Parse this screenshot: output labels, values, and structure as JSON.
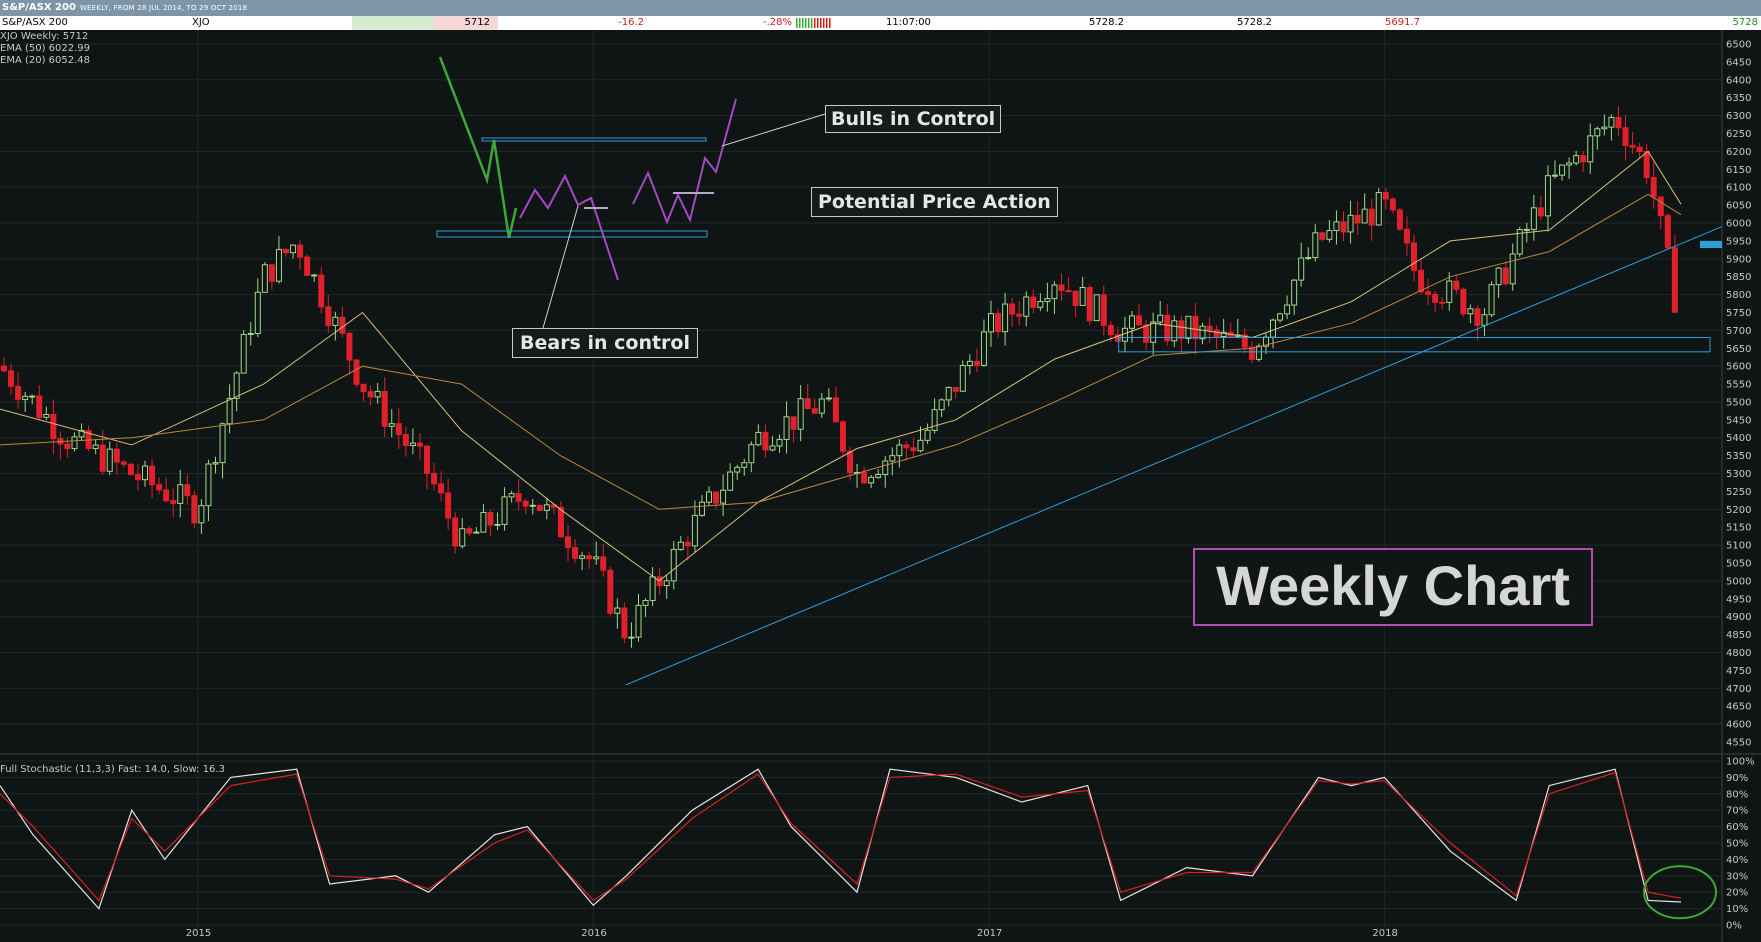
{
  "header": {
    "title": "S&P/ASX 200",
    "range": "WEEKLY, FROM 28 JUL 2014, TO 29 OCT 2018"
  },
  "quote": {
    "name": "S&P/ASX 200",
    "symbol": "XJO",
    "last": "5712",
    "change": "-16.2",
    "change_pct": "-.28%",
    "time": "11:07:00",
    "open": "5728.2",
    "high": "5728.2",
    "low": "5691.7",
    "close_edge": "5728"
  },
  "legend": {
    "price": "XJO Weekly: 5712",
    "ema50": "EMA (50) 6022.99",
    "ema20": "EMA (20) 6052.48",
    "stoch": "Full Stochastic (11,3,3) Fast: 14.0,  Slow: 16.3"
  },
  "annotations": {
    "bulls": "Bulls in Control",
    "bears": "Bears in control",
    "potential": "Potential Price Action",
    "weekly": "Weekly Chart"
  },
  "colors": {
    "up_candle": "#9fd98a",
    "down_candle": "#e0202a",
    "ema_fast": "#d8c07a",
    "ema_slow": "#b98a3c",
    "trendline": "#2e9fd8",
    "stoch_fast": "#e6e6e6",
    "stoch_slow": "#d82020",
    "bull_path": "#3aaa35",
    "bear_path": "#a24bc0",
    "circle": "#3aaa35"
  },
  "chart_data": [
    {
      "type": "candlestick",
      "y_axis": {
        "min": 4550,
        "max": 6500,
        "step": 50,
        "position": "right"
      },
      "ylim": [
        4550,
        6500
      ],
      "x_axis_labels": [
        "2015",
        "2016",
        "2017",
        "2018"
      ],
      "last_value": 5712,
      "series": [
        {
          "name": "XJO Weekly",
          "x": [
            "2014-07",
            "2014-09",
            "2014-11",
            "2015-01",
            "2015-03",
            "2015-04",
            "2015-06",
            "2015-08",
            "2015-09",
            "2015-11",
            "2016-01",
            "2016-02",
            "2016-04",
            "2016-06",
            "2016-08",
            "2016-09",
            "2016-11",
            "2017-01",
            "2017-03",
            "2017-05",
            "2017-07",
            "2017-09",
            "2017-11",
            "2018-01",
            "2018-02",
            "2018-04",
            "2018-06",
            "2018-08",
            "2018-09",
            "2018-10"
          ],
          "values": [
            5600,
            5400,
            5300,
            5200,
            5850,
            5950,
            5550,
            5300,
            5100,
            5250,
            5050,
            4850,
            5150,
            5400,
            5500,
            5300,
            5400,
            5700,
            5850,
            5700,
            5700,
            5650,
            5950,
            6050,
            5850,
            5750,
            6100,
            6300,
            6150,
            5712
          ]
        },
        {
          "name": "EMA (20)",
          "x": [
            "2014-07",
            "2014-11",
            "2015-03",
            "2015-06",
            "2015-09",
            "2015-12",
            "2016-03",
            "2016-06",
            "2016-09",
            "2016-12",
            "2017-03",
            "2017-06",
            "2017-09",
            "2017-12",
            "2018-03",
            "2018-06",
            "2018-09",
            "2018-10"
          ],
          "values": [
            5480,
            5380,
            5550,
            5750,
            5420,
            5200,
            5000,
            5220,
            5370,
            5450,
            5620,
            5720,
            5680,
            5780,
            5950,
            5980,
            6200,
            6052.48
          ]
        },
        {
          "name": "EMA (50)",
          "x": [
            "2014-07",
            "2014-11",
            "2015-03",
            "2015-06",
            "2015-09",
            "2015-12",
            "2016-03",
            "2016-06",
            "2016-09",
            "2016-12",
            "2017-03",
            "2017-06",
            "2017-09",
            "2017-12",
            "2018-03",
            "2018-06",
            "2018-09",
            "2018-10"
          ],
          "values": [
            5380,
            5400,
            5450,
            5600,
            5550,
            5350,
            5200,
            5220,
            5300,
            5380,
            5500,
            5630,
            5650,
            5720,
            5850,
            5920,
            6080,
            6022.99
          ]
        }
      ],
      "reference_levels": [
        5650,
        5900,
        6200
      ]
    },
    {
      "type": "line",
      "y_axis_labels": [
        "0%",
        "10%",
        "20%",
        "30%",
        "40%",
        "50%",
        "60%",
        "70%",
        "80%",
        "90%",
        "100%"
      ],
      "ylim": [
        0,
        100
      ],
      "series": [
        {
          "name": "Fast",
          "x": [
            "2014-07",
            "2014-08",
            "2014-10",
            "2014-11",
            "2014-12",
            "2015-02",
            "2015-04",
            "2015-05",
            "2015-07",
            "2015-08",
            "2015-10",
            "2015-11",
            "2016-01",
            "2016-02",
            "2016-04",
            "2016-06",
            "2016-07",
            "2016-09",
            "2016-10",
            "2016-12",
            "2017-02",
            "2017-04",
            "2017-05",
            "2017-07",
            "2017-09",
            "2017-11",
            "2017-12",
            "2018-01",
            "2018-03",
            "2018-05",
            "2018-06",
            "2018-08",
            "2018-09",
            "2018-10"
          ],
          "values": [
            85,
            55,
            10,
            70,
            40,
            90,
            95,
            25,
            30,
            20,
            55,
            60,
            12,
            30,
            70,
            95,
            60,
            20,
            95,
            90,
            75,
            85,
            15,
            35,
            30,
            90,
            85,
            90,
            45,
            15,
            85,
            95,
            15,
            14
          ]
        },
        {
          "name": "Slow",
          "x": [
            "2014-07",
            "2014-08",
            "2014-10",
            "2014-11",
            "2014-12",
            "2015-02",
            "2015-04",
            "2015-05",
            "2015-07",
            "2015-08",
            "2015-10",
            "2015-11",
            "2016-01",
            "2016-02",
            "2016-04",
            "2016-06",
            "2016-07",
            "2016-09",
            "2016-10",
            "2016-12",
            "2017-02",
            "2017-04",
            "2017-05",
            "2017-07",
            "2017-09",
            "2017-11",
            "2017-12",
            "2018-01",
            "2018-03",
            "2018-05",
            "2018-06",
            "2018-08",
            "2018-09",
            "2018-10"
          ],
          "values": [
            80,
            60,
            15,
            65,
            45,
            85,
            92,
            30,
            28,
            22,
            50,
            58,
            15,
            28,
            65,
            92,
            62,
            25,
            90,
            92,
            78,
            82,
            20,
            32,
            32,
            88,
            86,
            88,
            50,
            18,
            80,
            93,
            20,
            16.3
          ]
        }
      ]
    }
  ]
}
